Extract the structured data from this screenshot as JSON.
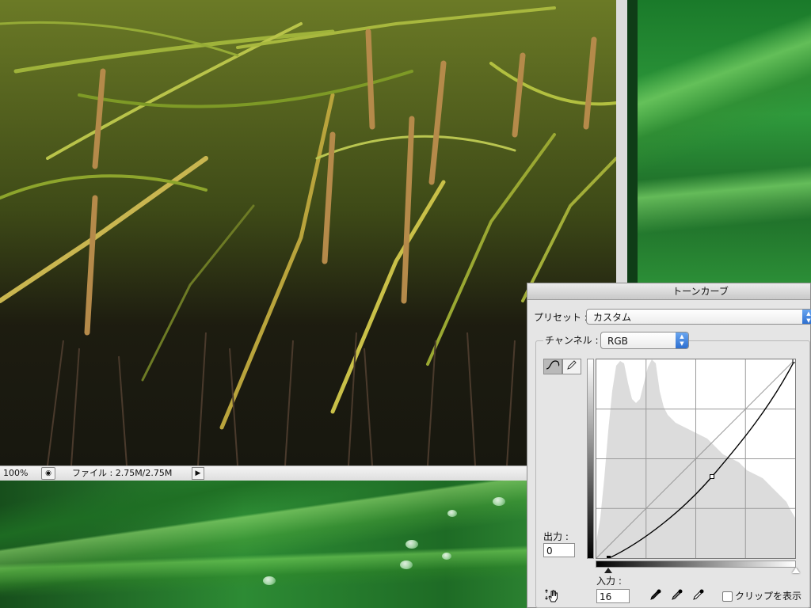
{
  "document": {
    "zoom": "100%",
    "info": "ファイル : 2.75M/2.75M"
  },
  "curves": {
    "title": "トーンカーブ",
    "preset_label": "プリセット :",
    "preset_value": "カスタム",
    "channel_label": "チャンネル :",
    "channel_value": "RGB",
    "output_label": "出力 :",
    "output_value": "0",
    "input_label": "入力 :",
    "input_value": "16",
    "clip_label": "クリップを表示",
    "clip_checked": false
  },
  "icons": {
    "curve_tool": "curve-icon",
    "pencil_tool": "pencil-icon",
    "hand_tool": "hand-adjust-icon",
    "black_point": "eyedropper-black-icon",
    "gray_point": "eyedropper-gray-icon",
    "white_point": "eyedropper-white-icon"
  }
}
